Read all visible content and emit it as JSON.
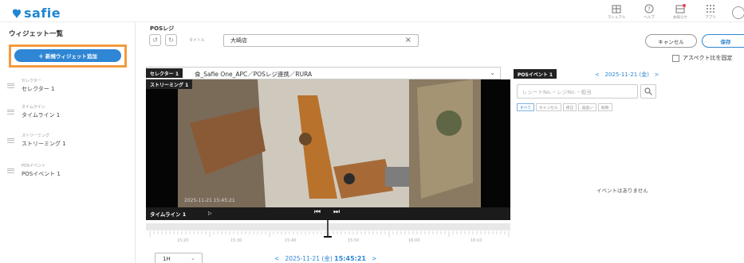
{
  "header": {
    "logo": "safie",
    "icons": [
      {
        "icon": "manual-icon",
        "label": "マニュアル"
      },
      {
        "icon": "help-icon",
        "label": "ヘルプ"
      },
      {
        "icon": "notice-icon",
        "label": "お知らせ"
      },
      {
        "icon": "apps-icon",
        "label": "アプリ"
      }
    ]
  },
  "sidebar": {
    "title": "ウィジェット一覧",
    "add_button": "＋ 新規ウィジェット追加",
    "widgets": [
      {
        "type": "セレクター",
        "name": "セレクター 1"
      },
      {
        "type": "タイムライン",
        "name": "タイムライン 1"
      },
      {
        "type": "ストリーミング",
        "name": "ストリーミング 1"
      },
      {
        "type": "POSイベント",
        "name": "POSイベント 1"
      }
    ]
  },
  "main": {
    "page_title": "POSレジ",
    "title_label": "タイトル",
    "title_value": "大崎店",
    "cancel": "キャンセル",
    "save": "保存",
    "aspect_label": "アスペクト比を固定"
  },
  "selector": {
    "tag": "セレクター 1",
    "path": "食_Safie One_APC／POSレジ連携／RURA"
  },
  "streaming": {
    "tag": "ストリーミング 1",
    "timestamp": "2025-11-21 15:45:21"
  },
  "timeline": {
    "tag": "タイムライン 1",
    "tick_labels": [
      "15:20",
      "15:30",
      "15:40",
      "15:50",
      "16:00",
      "16:10"
    ],
    "range": "1H",
    "date": "2025-11-21 (金)",
    "time": "15:45:21"
  },
  "pos": {
    "tag": "POSイベント 1",
    "date": "2025-11-21 (金)",
    "search_placeholder": "レシートNo.・レジNo.・担当",
    "chips": [
      "すべて",
      "キャンセル",
      "修正",
      "返品い",
      "削除"
    ],
    "empty": "イベントはありません"
  },
  "colors": {
    "accent": "#2f86d4",
    "highlight": "#f39a3e"
  }
}
